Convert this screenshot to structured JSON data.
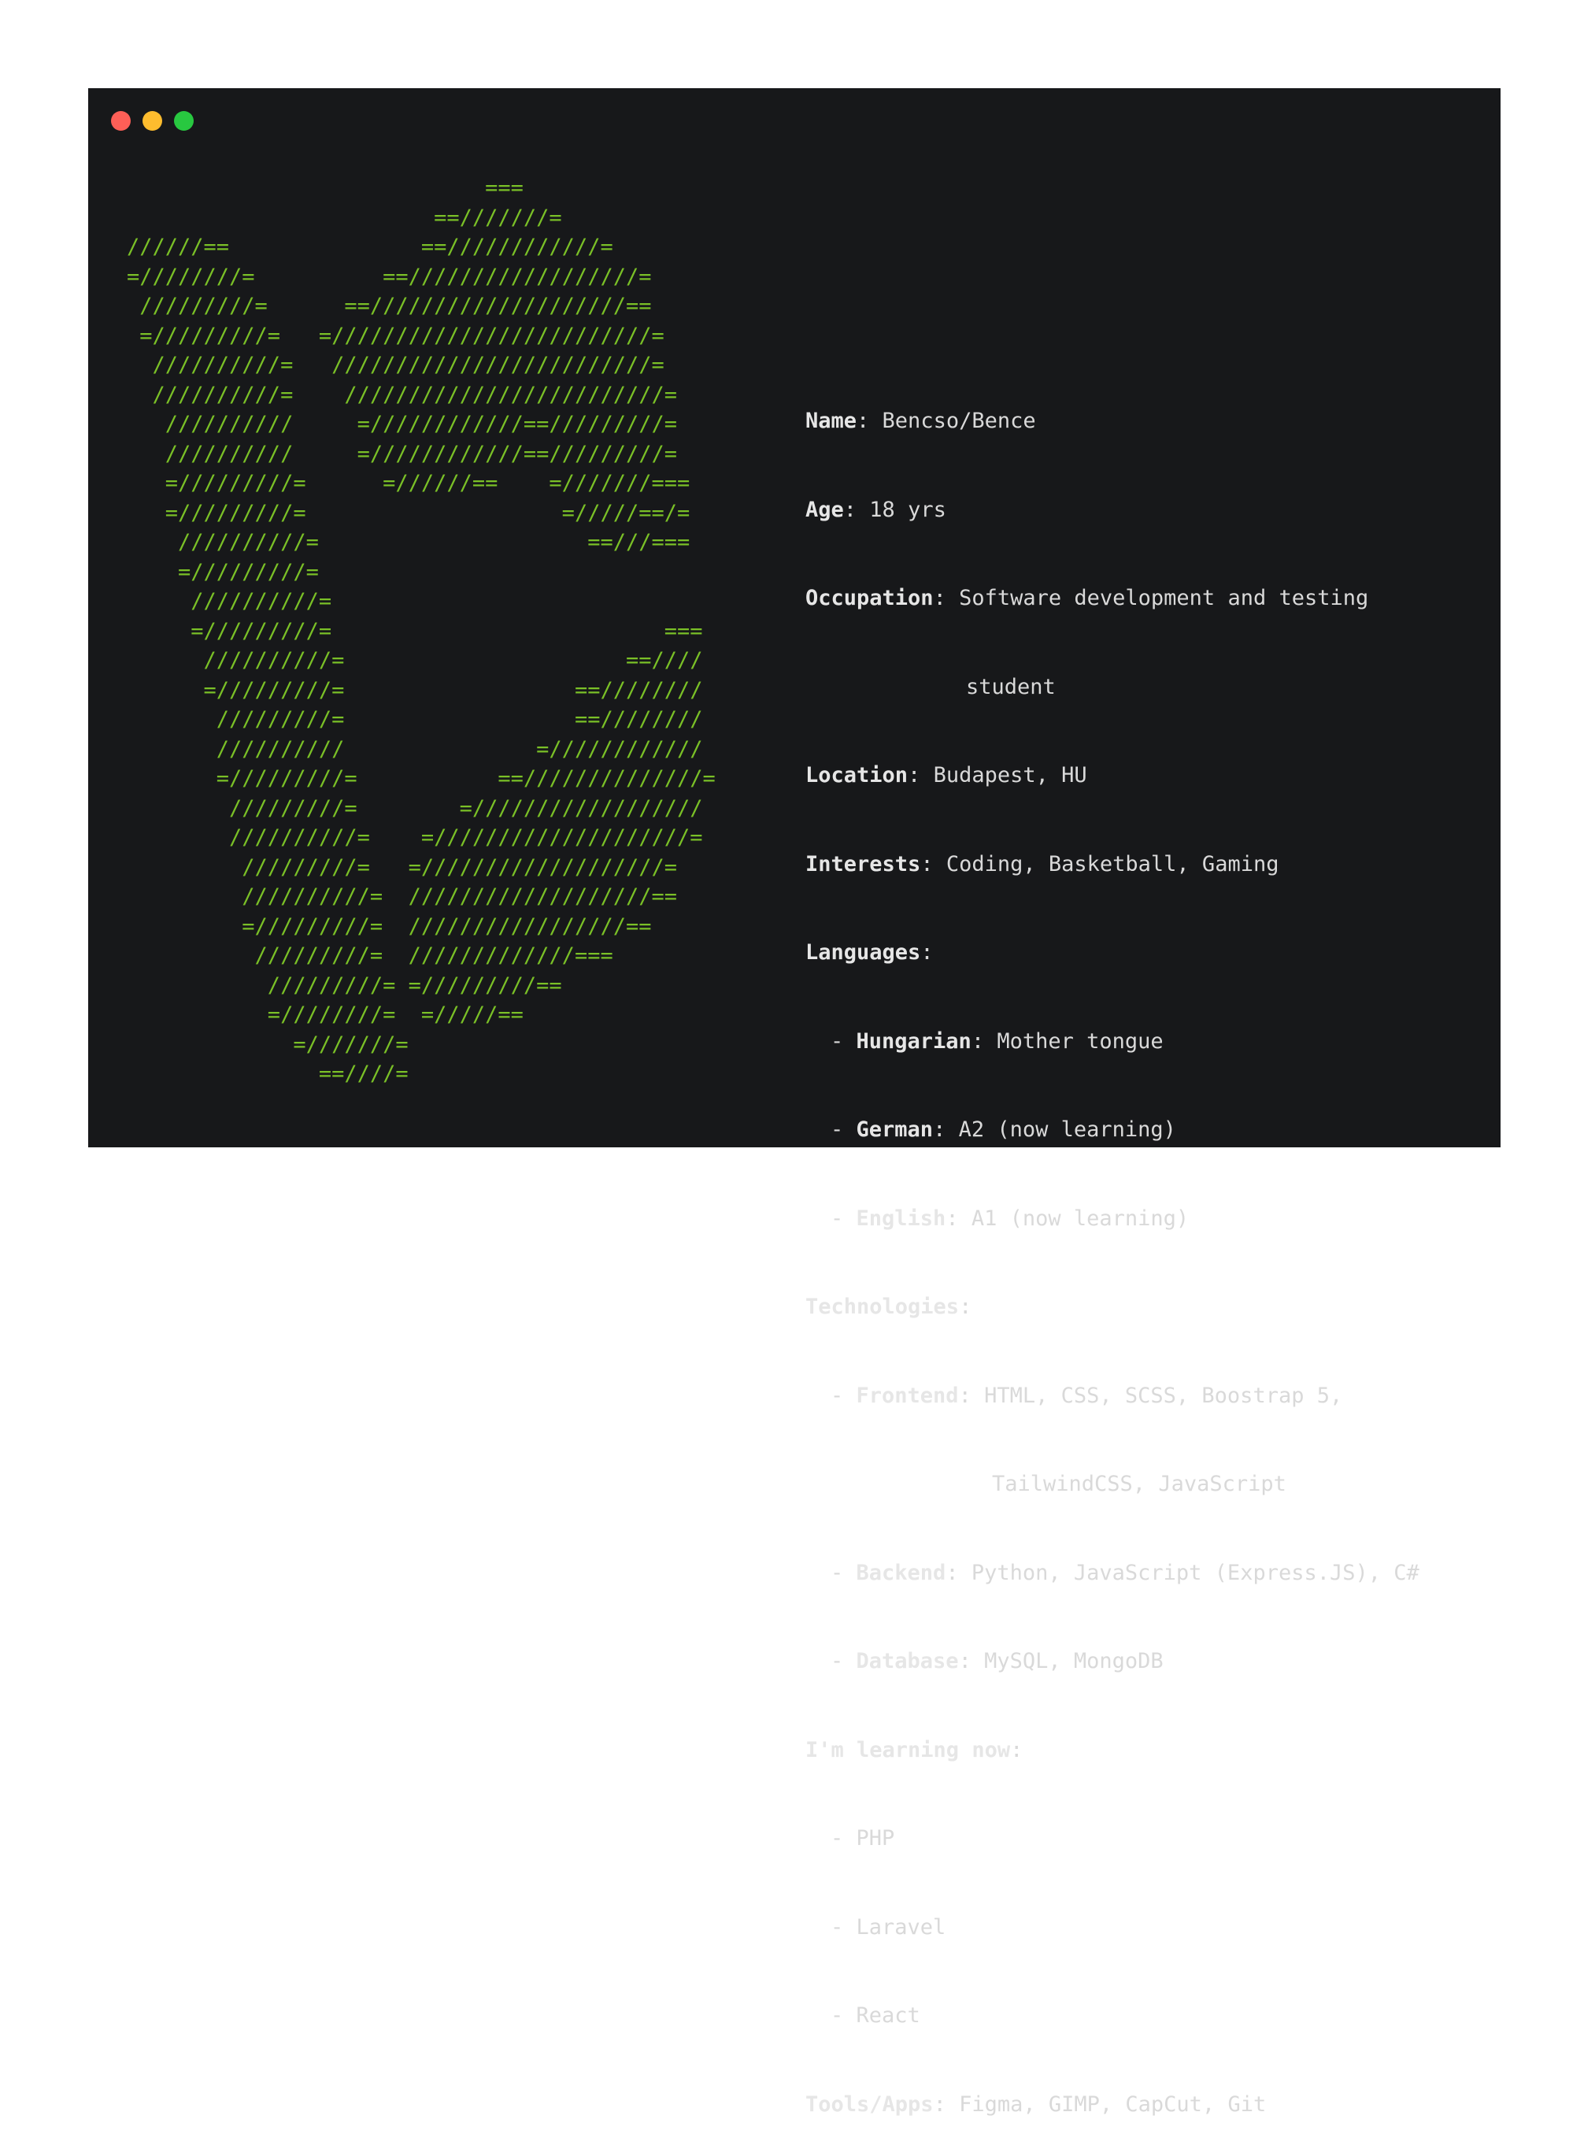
{
  "window": {
    "background": "#17181a",
    "traffic_lights": [
      {
        "name": "close",
        "color": "#fe5f57"
      },
      {
        "name": "minimize",
        "color": "#febc2e"
      },
      {
        "name": "maximize",
        "color": "#28c840"
      }
    ]
  },
  "ascii_art": {
    "color": "#7ac027",
    "lines": [
      "                            ===",
      "                        ==///////=",
      "//////==               ==////////////=",
      "=////////=          ==//////////////////=",
      " /////////=      ==////////////////////==",
      " =/////////=   =/////////////////////////=",
      "  //////////=   /////////////////////////=",
      "  //////////=    /////////////////////////=",
      "   //////////     =////////////==/////////=",
      "   //////////     =////////////==/////////=",
      "   =/////////=      =//////==    =///////===",
      "   =/////////=                    =/////==/=",
      "    //////////=                     ==///===",
      "    =/////////=",
      "     //////////=",
      "     =/////////=                          ===",
      "      //////////=                      ==////",
      "      =/////////=                  ==////////",
      "       /////////=                  ==////////",
      "       //////////               =////////////",
      "       =/////////=           ==//////////////=",
      "        /////////=        =//////////////////",
      "        //////////=    =////////////////////=",
      "         /////////=   =///////////////////=",
      "         //////////=  ///////////////////==",
      "         =/////////=  /////////////////==",
      "          /////////=  /////////////===",
      "           /////////= =/////////==",
      "           =////////=  =/////==",
      "             =///////=",
      "               ==////="
    ]
  },
  "profile": {
    "name_label": "Name",
    "name_value": "Bencso/Bence",
    "age_label": "Age",
    "age_value": "18 yrs",
    "occupation_label": "Occupation",
    "occupation_value_line1": "Software development and testing",
    "occupation_value_line2": "student",
    "location_label": "Location",
    "location_value": "Budapest, HU",
    "interests_label": "Interests",
    "interests_value": "Coding, Basketball, Gaming",
    "languages_label": "Languages",
    "languages": [
      {
        "label": "Hungarian",
        "value": "Mother tongue"
      },
      {
        "label": "German",
        "value": "A2 (now learning)"
      },
      {
        "label": "English",
        "value": "A1 (now learning)"
      }
    ],
    "technologies_label": "Technologies",
    "frontend_label": "Frontend",
    "frontend_value_line1": "HTML, CSS, SCSS, Boostrap 5,",
    "frontend_value_line2": "TailwindCSS, JavaScript",
    "backend_label": "Backend",
    "backend_value": "Python, JavaScript (Express.JS), C#",
    "database_label": "Database",
    "database_value": "MySQL, MongoDB",
    "learning_label": "I'm learning now",
    "learning_items": [
      "PHP",
      "Laravel",
      "React"
    ],
    "tools_label": "Tools/Apps",
    "tools_value": "Figma, GIMP, CapCut, Git"
  }
}
